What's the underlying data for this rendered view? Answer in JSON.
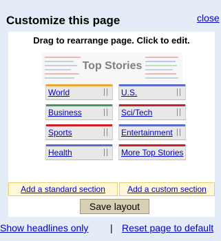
{
  "panel": {
    "title": "Customize this page",
    "close_label": "close"
  },
  "instructions": "Drag to rearrange page.  Click to edit.",
  "top_stories": {
    "title": "Top Stories"
  },
  "sections": [
    {
      "label": "World",
      "color": "#e8a72f"
    },
    {
      "label": "U.S.",
      "color": "#5b6bc8"
    },
    {
      "label": "Business",
      "color": "#3b9b57"
    },
    {
      "label": "Sci/Tech",
      "color": "#cc1f26"
    },
    {
      "label": "Sports",
      "color": "#cc1f26"
    },
    {
      "label": "Entertainment",
      "color": "#5b6bc8"
    },
    {
      "label": "Health",
      "color": "#5b6bc8"
    },
    {
      "label": "More Top Stories",
      "color": "#cc1f26"
    }
  ],
  "actions": {
    "add_standard": "Add a standard section",
    "add_custom": "Add a custom section",
    "save": "Save layout"
  },
  "footer": {
    "headlines_only": "Show headlines only",
    "separator": "|",
    "reset": "Reset page to default"
  }
}
